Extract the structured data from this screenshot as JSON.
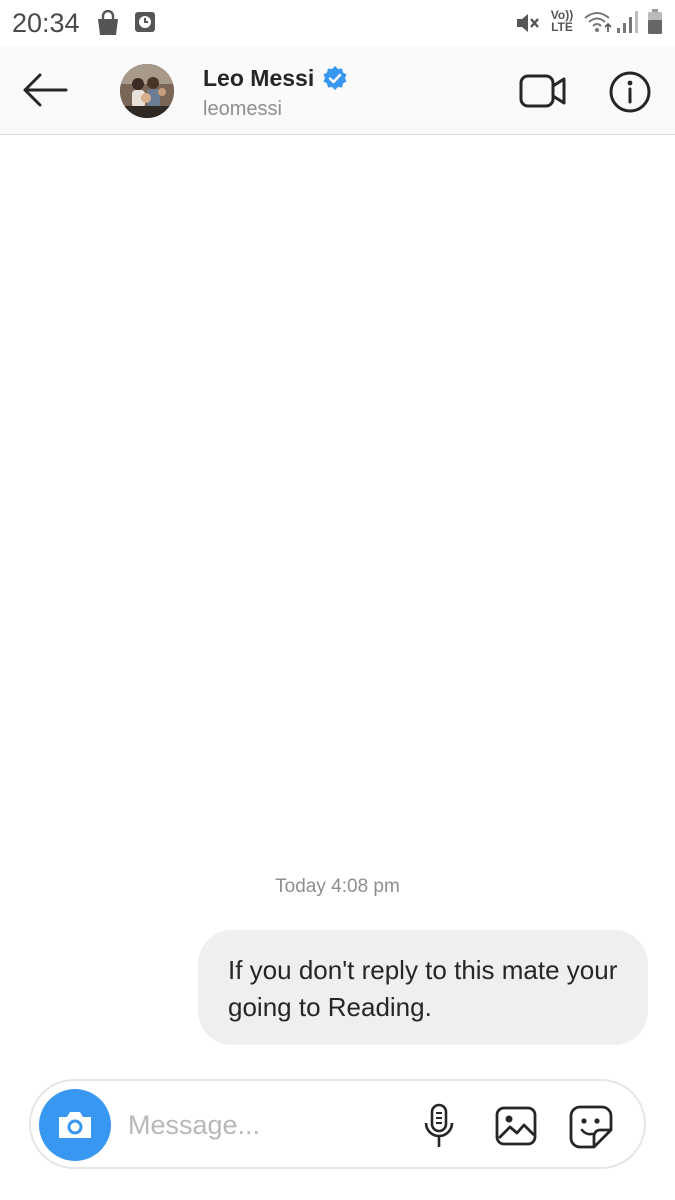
{
  "status_bar": {
    "time": "20:34",
    "icons": [
      "shopping-bag-icon",
      "clock-notification-icon",
      "mute-icon",
      "volte-icon",
      "wifi-icon",
      "signal-icon",
      "battery-icon"
    ],
    "volte_label": "Vo)) LTE"
  },
  "header": {
    "contact_name": "Leo Messi",
    "username": "leomessi",
    "verified": true,
    "icons": [
      "back-arrow-icon",
      "avatar",
      "verified-badge-icon",
      "video-call-icon",
      "info-icon"
    ]
  },
  "thread": {
    "timestamp": "Today 4:08 pm",
    "messages": [
      {
        "sender": "me",
        "text": "If you don't reply to this mate your going to Reading."
      }
    ]
  },
  "composer": {
    "placeholder": "Message...",
    "value": "",
    "icons": [
      "camera-icon",
      "microphone-icon",
      "gallery-icon",
      "sticker-icon"
    ]
  },
  "colors": {
    "accent": "#3897f0",
    "verified": "#3897f0",
    "bubble": "#efefef",
    "secondary_text": "#8e8e8e"
  }
}
